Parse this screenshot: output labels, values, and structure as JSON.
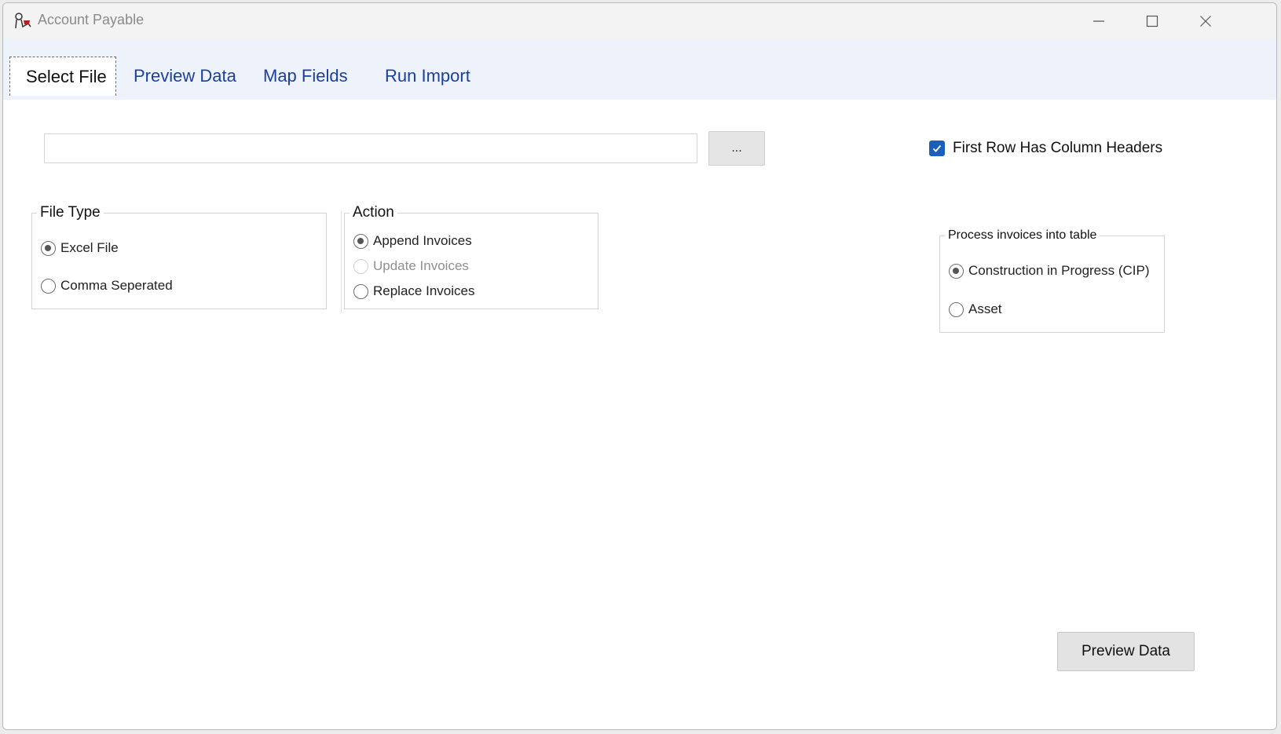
{
  "window": {
    "title": "Account Payable"
  },
  "tabs": [
    {
      "label": "Select File",
      "active": true
    },
    {
      "label": "Preview Data",
      "active": false
    },
    {
      "label": "Map Fields",
      "active": false
    },
    {
      "label": "Run Import",
      "active": false
    }
  ],
  "file_select": {
    "path_value": "",
    "browse_label": "...",
    "first_row_headers": {
      "label": "First Row Has Column Headers",
      "checked": true
    }
  },
  "file_type": {
    "legend": "File Type",
    "options": [
      {
        "label": "Excel File",
        "checked": true
      },
      {
        "label": "Comma Seperated",
        "checked": false
      }
    ]
  },
  "action": {
    "legend": "Action",
    "options": [
      {
        "label": "Append Invoices",
        "checked": true,
        "disabled": false
      },
      {
        "label": "Update Invoices",
        "checked": false,
        "disabled": true
      },
      {
        "label": "Replace Invoices",
        "checked": false,
        "disabled": false
      }
    ]
  },
  "process_table": {
    "legend": "Process invoices into table",
    "options": [
      {
        "label": "Construction in Progress (CIP)",
        "checked": true
      },
      {
        "label": "Asset",
        "checked": false
      }
    ]
  },
  "footer": {
    "preview_button": "Preview Data"
  },
  "colors": {
    "accent": "#1b5fbd",
    "tab_text": "#1c3f9e",
    "tabstrip_bg": "#eef3fb"
  },
  "icons": [
    "app-icon",
    "minimize-icon",
    "maximize-icon",
    "close-icon",
    "checkmark-icon"
  ]
}
